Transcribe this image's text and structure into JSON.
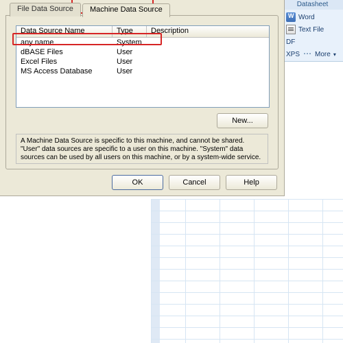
{
  "ribbon": {
    "group_title": "Datasheet",
    "items": {
      "word": "Word",
      "textfile": "Text File",
      "pdf": "PDF or XPS",
      "more": "More",
      "pdf_short": "DF",
      "xps_short": "XPS"
    }
  },
  "dialog": {
    "tabs": {
      "file": "File Data Source",
      "machine": "Machine Data Source"
    },
    "columns": {
      "name": "Data Source Name",
      "type": "Type",
      "desc": "Description"
    },
    "rows": [
      {
        "name": "any name",
        "type": "System",
        "desc": ""
      },
      {
        "name": "dBASE Files",
        "type": "User",
        "desc": ""
      },
      {
        "name": "Excel Files",
        "type": "User",
        "desc": ""
      },
      {
        "name": "MS Access Database",
        "type": "User",
        "desc": ""
      }
    ],
    "new_btn": "New...",
    "explain": "A Machine Data Source is specific to this machine, and cannot be shared. \"User\" data sources are specific to a user on this machine. \"System\" data sources can be used by all users on this machine, or by a system-wide service.",
    "buttons": {
      "ok": "OK",
      "cancel": "Cancel",
      "help": "Help"
    }
  }
}
